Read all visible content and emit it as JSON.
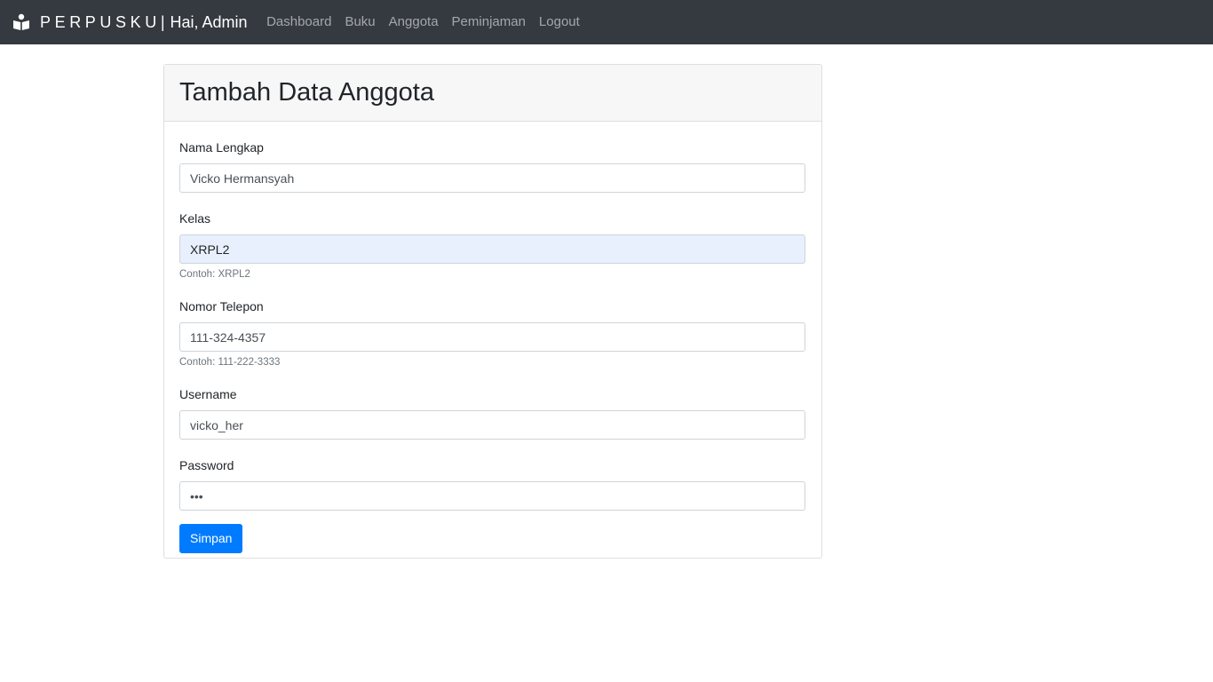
{
  "navbar": {
    "brand_icon": "book-reader-icon",
    "brand_name": "PERPUSKU",
    "separator": "|",
    "greeting": "Hai, Admin",
    "links": [
      "Dashboard",
      "Buku",
      "Anggota",
      "Peminjaman",
      "Logout"
    ]
  },
  "card": {
    "title": "Tambah Data Anggota"
  },
  "form": {
    "nama": {
      "label": "Nama Lengkap",
      "value": "Vicko Hermansyah"
    },
    "kelas": {
      "label": "Kelas",
      "value": "XRPL2",
      "hint": "Contoh: XRPL2"
    },
    "telepon": {
      "label": "Nomor Telepon",
      "value": "111-324-4357",
      "hint": "Contoh: 111-222-3333"
    },
    "username": {
      "label": "Username",
      "value": "vicko_her"
    },
    "password": {
      "label": "Password",
      "value": "abc"
    },
    "submit_label": "Simpan"
  },
  "colors": {
    "navbar_bg": "#343a40",
    "primary": "#007bff",
    "autofill_bg": "#e8f0fe"
  }
}
